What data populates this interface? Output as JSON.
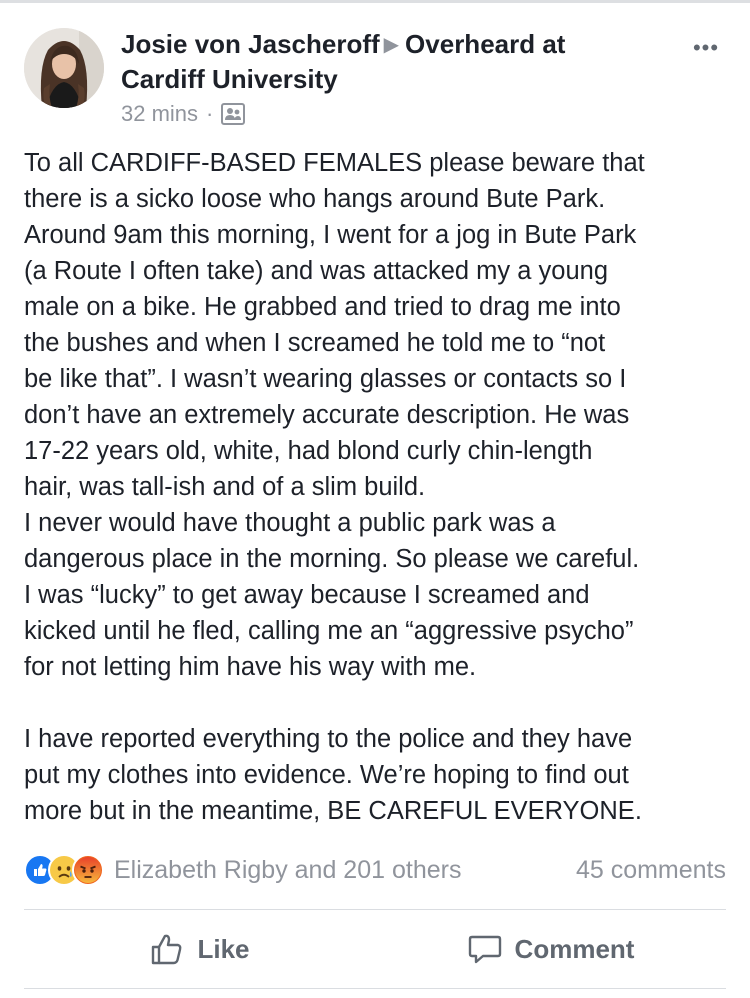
{
  "post": {
    "author": "Josie von Jascheroff",
    "group": "Overheard at Cardiff University",
    "group_line1": "Overheard at",
    "group_line2": "Cardiff University",
    "timestamp": "32 mins",
    "separator": "·",
    "audience_icon": "group-audience-icon",
    "body_lines": [
      "To all CARDIFF-BASED FEMALES please beware that",
      "there is a sicko loose who hangs around Bute Park.",
      "Around 9am this morning, I went for a jog in Bute Park",
      "(a Route I often take) and was attacked my a young",
      "male on a bike. He grabbed and tried to drag me into",
      "the bushes and when I screamed he told me to “not",
      "be like that”. I wasn’t wearing glasses or contacts so I",
      "don’t have an extremely accurate description. He was",
      "17-22 years old, white, had blond curly chin-length",
      "hair, was tall-ish and of a slim build.",
      "I never would have thought a public park was a",
      "dangerous place in the morning. So please we careful.",
      "I was “lucky” to get away because I screamed and",
      "kicked until he fled, calling me an “aggressive psycho”",
      "for not letting him have his way with me.",
      "",
      "I have reported everything to the police and they have",
      "put my clothes into evidence. We’re hoping to find out",
      "more but in the meantime, BE CAREFUL EVERYONE."
    ]
  },
  "reactions": {
    "types": [
      "like",
      "sad",
      "angry"
    ],
    "reactors_text": "Elizabeth Rigby and 201 others",
    "comments_text": "45 comments"
  },
  "actions": {
    "like_label": "Like",
    "comment_label": "Comment"
  },
  "colors": {
    "text": "#1d2129",
    "secondary": "#90949c",
    "action": "#606770",
    "like_blue": "#1877f2",
    "divider": "#dadde1"
  }
}
